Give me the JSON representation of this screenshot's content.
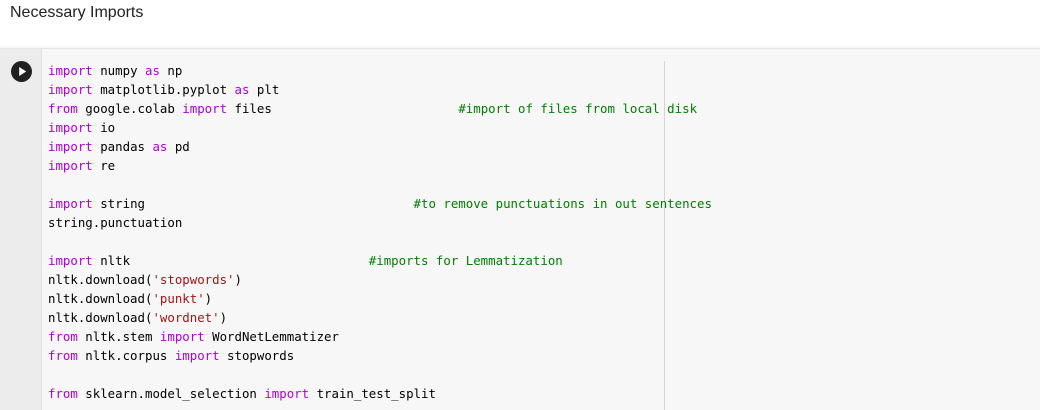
{
  "section": {
    "title": "Necessary Imports"
  },
  "colors": {
    "keyword": "#af00db",
    "string": "#a31515",
    "comment": "#008000",
    "plain": "#000000"
  },
  "cell": {
    "run_icon": "play-circle-icon",
    "lines": [
      [
        {
          "t": "kw",
          "v": "import"
        },
        {
          "t": "p",
          "v": " numpy "
        },
        {
          "t": "kw",
          "v": "as"
        },
        {
          "t": "p",
          "v": " np"
        }
      ],
      [
        {
          "t": "kw",
          "v": "import"
        },
        {
          "t": "p",
          "v": " matplotlib.pyplot "
        },
        {
          "t": "kw",
          "v": "as"
        },
        {
          "t": "p",
          "v": " plt"
        }
      ],
      [
        {
          "t": "kw",
          "v": "from"
        },
        {
          "t": "p",
          "v": " google.colab "
        },
        {
          "t": "kw",
          "v": "import"
        },
        {
          "t": "p",
          "v": " files                         "
        },
        {
          "t": "cmt",
          "v": "#import of files from local disk"
        }
      ],
      [
        {
          "t": "kw",
          "v": "import"
        },
        {
          "t": "p",
          "v": " io"
        }
      ],
      [
        {
          "t": "kw",
          "v": "import"
        },
        {
          "t": "p",
          "v": " pandas "
        },
        {
          "t": "kw",
          "v": "as"
        },
        {
          "t": "p",
          "v": " pd"
        }
      ],
      [
        {
          "t": "kw",
          "v": "import"
        },
        {
          "t": "p",
          "v": " re"
        }
      ],
      [],
      [
        {
          "t": "kw",
          "v": "import"
        },
        {
          "t": "p",
          "v": " string                                    "
        },
        {
          "t": "cmt",
          "v": "#to remove punctuations in out sentences"
        }
      ],
      [
        {
          "t": "p",
          "v": "string.punctuation"
        }
      ],
      [],
      [
        {
          "t": "kw",
          "v": "import"
        },
        {
          "t": "p",
          "v": " nltk                                "
        },
        {
          "t": "cmt",
          "v": "#imports for Lemmatization"
        }
      ],
      [
        {
          "t": "p",
          "v": "nltk.download("
        },
        {
          "t": "str",
          "v": "'stopwords'"
        },
        {
          "t": "p",
          "v": ")"
        }
      ],
      [
        {
          "t": "p",
          "v": "nltk.download("
        },
        {
          "t": "str",
          "v": "'punkt'"
        },
        {
          "t": "p",
          "v": ")"
        }
      ],
      [
        {
          "t": "p",
          "v": "nltk.download("
        },
        {
          "t": "str",
          "v": "'wordnet'"
        },
        {
          "t": "p",
          "v": ")"
        }
      ],
      [
        {
          "t": "kw",
          "v": "from"
        },
        {
          "t": "p",
          "v": " nltk.stem "
        },
        {
          "t": "kw",
          "v": "import"
        },
        {
          "t": "p",
          "v": " WordNetLemmatizer"
        }
      ],
      [
        {
          "t": "kw",
          "v": "from"
        },
        {
          "t": "p",
          "v": " nltk.corpus "
        },
        {
          "t": "kw",
          "v": "import"
        },
        {
          "t": "p",
          "v": " stopwords"
        }
      ],
      [],
      [
        {
          "t": "kw",
          "v": "from"
        },
        {
          "t": "p",
          "v": " sklearn.model_selection "
        },
        {
          "t": "kw",
          "v": "import"
        },
        {
          "t": "p",
          "v": " train_test_split"
        }
      ]
    ]
  }
}
